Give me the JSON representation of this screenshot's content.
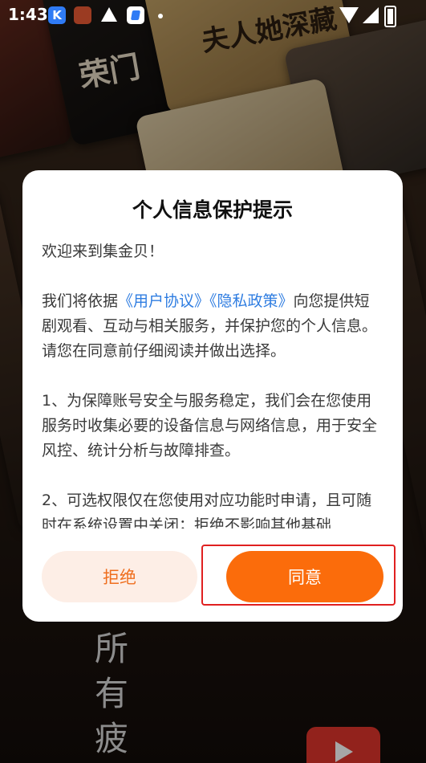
{
  "status_bar": {
    "time": "1:43",
    "k_icon": "K"
  },
  "background": {
    "poster_title_1": "荣门",
    "poster_title_2": "夫人她深藏",
    "vertical_text": "所有疲"
  },
  "dialog": {
    "title": "个人信息保护提示",
    "welcome": "欢迎来到集金贝！",
    "intro_prefix": "我们将依据",
    "user_agreement_link": "《用户协议》",
    "privacy_policy_link": "《隐私政策》",
    "intro_suffix": "向您提供短剧观看、互动与相关服务，并保护您的个人信息。请您在同意前仔细阅读并做出选择。",
    "item_1": "1、为保障账号安全与服务稳定，我们会在您使用服务时收集必要的设备信息与网络信息，用于安全风控、统计分析与故障排查。",
    "item_2": "2、可选权限仅在您使用对应功能时申请，且可随时在系统设置中关闭；拒绝不影响其他基础",
    "reject_label": "拒绝",
    "agree_label": "同意"
  },
  "colors": {
    "accent": "#fb6c0b",
    "reject_bg": "#fdeee6",
    "link": "#2f7de1",
    "highlight": "#e02020"
  }
}
